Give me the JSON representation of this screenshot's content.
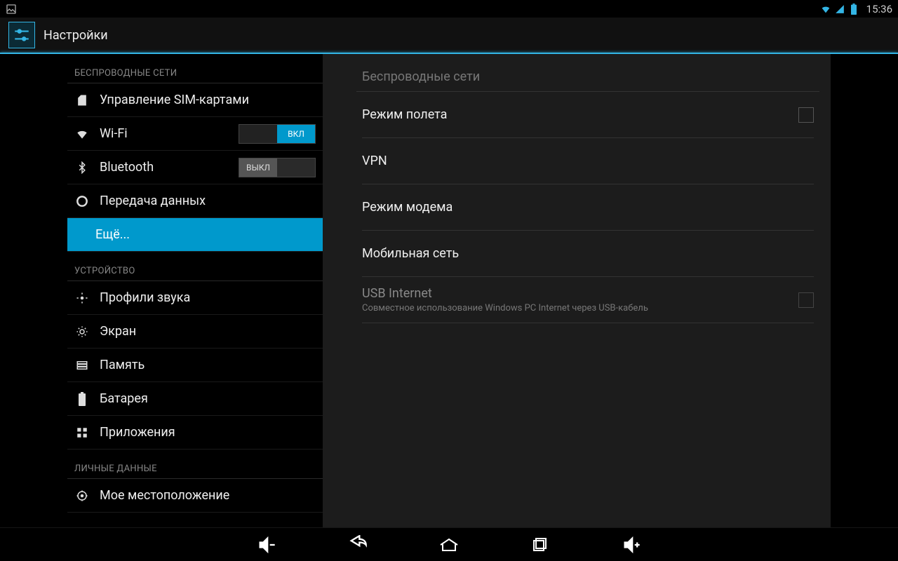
{
  "status": {
    "time": "15:36"
  },
  "actionbar": {
    "title": "Настройки"
  },
  "sidebar": {
    "sections": [
      {
        "header": "БЕСПРОВОДНЫЕ СЕТИ",
        "items": [
          {
            "label": "Управление SIM-картами"
          },
          {
            "label": "Wi-Fi",
            "toggle": "on",
            "toggle_label": "ВКЛ"
          },
          {
            "label": "Bluetooth",
            "toggle": "off",
            "toggle_label": "ВЫКЛ"
          },
          {
            "label": "Передача данных"
          },
          {
            "label": "Ещё...",
            "selected": true
          }
        ]
      },
      {
        "header": "УСТРОЙСТВО",
        "items": [
          {
            "label": "Профили звука"
          },
          {
            "label": "Экран"
          },
          {
            "label": "Память"
          },
          {
            "label": "Батарея"
          },
          {
            "label": "Приложения"
          }
        ]
      },
      {
        "header": "ЛИЧНЫЕ ДАННЫЕ",
        "items": [
          {
            "label": "Мое местоположение"
          }
        ]
      }
    ]
  },
  "content": {
    "header": "Беспроводные сети",
    "items": [
      {
        "primary": "Режим полета",
        "checkbox": true
      },
      {
        "primary": "VPN"
      },
      {
        "primary": "Режим модема"
      },
      {
        "primary": "Мобильная сеть"
      },
      {
        "primary": "USB Internet",
        "secondary": "Совместное использование Windows PC Internet через USB-кабель",
        "checkbox": true,
        "disabled": true
      }
    ]
  },
  "colors": {
    "accent": "#33b5e5",
    "selected": "#0099cc"
  }
}
